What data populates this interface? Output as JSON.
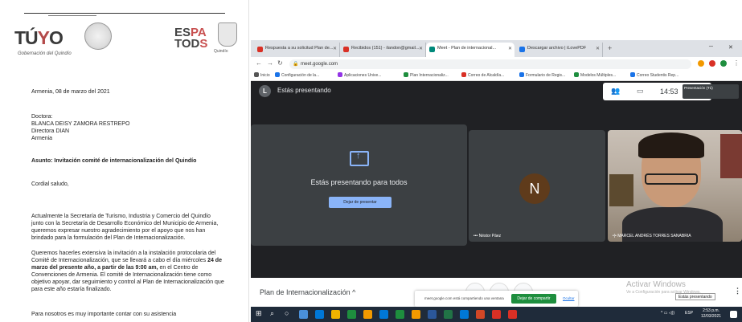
{
  "document": {
    "header": {
      "brand_left": "TÚYO",
      "brand_left_sub": "Gobernación del Quindío",
      "brand_right": "ESPATODOS",
      "shield_label": "Quindío"
    },
    "date_line": "Armenia, 08 de marzo del 2021",
    "salutation_title": "Doctora:",
    "recipient_name": "BLANCA DEISY ZAMORA RESTREPO",
    "recipient_role": "Directora DIAN",
    "recipient_city": "Armenia",
    "subject_label": "Asunto:",
    "subject_text": "Invitación comité de internacionalización del Quindío",
    "greeting": "Cordial saludo,",
    "paragraph_1": "Actualmente la Secretaría de Turismo, Industria y Comercio del Quindío junto con la Secretaría de Desarrollo Económico del Municipio de Armenia, queremos expresar nuestro agradecimiento por el apoyo que nos han brindado para la formulación del Plan de Internacionalización.",
    "paragraph_2a": "Queremos hacerles extensiva la invitación a la instalación protocolaria del Comité de Internacionalización, que se llevará a cabo el día miércoles",
    "paragraph_2_bold": "24 de marzo del presente año, a partir de las 9:00 am,",
    "paragraph_2b": "en el Centro de Convenciones de Armenia. El comité de Internacionalización tiene como objetivo apoyar, dar seguimiento y control al Plan de Internacionalización que para este año estaría finalizado.",
    "paragraph_3": "Para nosotros es muy importante contar con su asistencia"
  },
  "browser": {
    "tabs": [
      {
        "label": "Respuesta a su solicitud Plan de...",
        "color": "#d93025"
      },
      {
        "label": "Recibidos (151) - ilandon@gmail...",
        "color": "#d93025"
      },
      {
        "label": "Meet - Plan de internacional...",
        "color": "#00897b",
        "active": true
      },
      {
        "label": "Descargar archivo | iLovePDF",
        "color": "#1a73e8"
      }
    ],
    "new_tab": "+",
    "url": "meet.google.com",
    "bookmarks": [
      {
        "label": "Inicio",
        "color": "#555"
      },
      {
        "label": "Configuración de la...",
        "color": "#1a73e8"
      },
      {
        "label": "Aplicaciones Unive...",
        "color": "#9334e6"
      },
      {
        "label": "Plan Internacionaliz...",
        "color": "#1e8e3e"
      },
      {
        "label": "Correo de Alcaldía...",
        "color": "#d93025"
      },
      {
        "label": "Formulario de Regis...",
        "color": "#1a73e8"
      },
      {
        "label": "Modelos Múltiples...",
        "color": "#1e8e3e"
      },
      {
        "label": "Correo Studentis Rep...",
        "color": "#1a73e8"
      }
    ]
  },
  "meet": {
    "you_initial": "L",
    "presenting_status": "Estás presentando",
    "clock": "14:53",
    "mini_tile_label": "Presentación (Tú)",
    "presenting_to_all": "Estás presentando para todos",
    "stop_presenting": "Dejar de presentar",
    "participants": [
      {
        "initial": "N",
        "name": "Néstor Páez",
        "avatar_color": "#5f3b1b"
      },
      {
        "name": "MARCEL ANDRÉS TORRES SANABRIA"
      }
    ],
    "meeting_name": "Plan de Internacionalización",
    "share_message": "meet.google.com está compartiendo una ventana",
    "share_stop": "Dejar de compartir",
    "share_hide": "Ocultar",
    "activate_title": "Activar Windows",
    "activate_sub": "Ve a Configuración para activar Windows.",
    "presenting_tooltip": "Estás presentando"
  },
  "taskbar": {
    "tray_text": "ESP",
    "time": "2:53 p.m.",
    "date": "12/03/2021"
  }
}
